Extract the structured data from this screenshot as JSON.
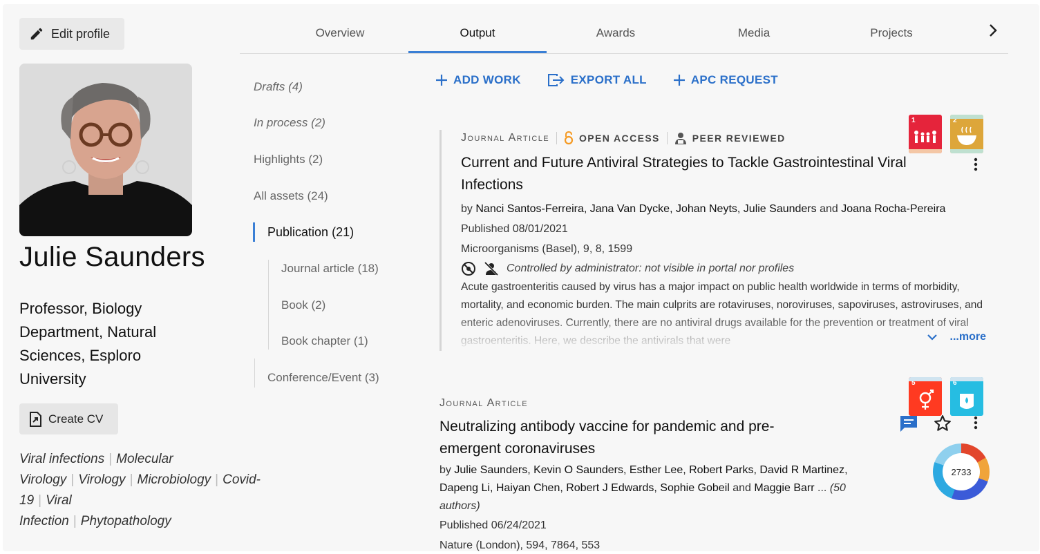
{
  "profile": {
    "edit_label": "Edit profile",
    "name": "Julie Saunders",
    "position": "Professor, Biology Department, Natural Sciences, Esploro University",
    "create_cv_label": "Create CV",
    "keywords": [
      "Viral infections",
      "Molecular Virology",
      "Virology",
      "Microbiology",
      "Covid-19",
      "Viral Infection",
      "Phytopathology"
    ]
  },
  "tabs": [
    {
      "label": "Overview"
    },
    {
      "label": "Output"
    },
    {
      "label": "Awards"
    },
    {
      "label": "Media"
    },
    {
      "label": "Projects"
    }
  ],
  "active_tab": "Output",
  "subnav": {
    "drafts": "Drafts",
    "drafts_count": "(4)",
    "in_process": "In process",
    "in_process_count": "(2)",
    "highlights": "Highlights",
    "highlights_count": "(2)",
    "all_assets": "All assets",
    "all_assets_count": "(24)",
    "publication": "Publication",
    "publication_count": "(21)",
    "journal_article": "Journal article",
    "journal_article_count": "(18)",
    "book": "Book",
    "book_count": "(2)",
    "book_chapter": "Book chapter",
    "book_chapter_count": "(1)",
    "conference": "Conference/Event",
    "conference_count": "(3)"
  },
  "actions": {
    "add_work": "ADD WORK",
    "export_all": "EXPORT ALL",
    "apc_request": "APC REQUEST"
  },
  "result1": {
    "type": "Journal Article",
    "open_access": "OPEN ACCESS",
    "peer_reviewed": "PEER REVIEWED",
    "title": "Current and Future Antiviral Strategies to Tackle Gastrointestinal Viral Infections",
    "by": "by",
    "authors_main": "Nanci Santos-Ferreira, Jana Van Dycke, Johan Neyts, Julie Saunders",
    "and": "and",
    "author_last": "Joana Rocha-Pereira",
    "published": "Published 08/01/2021",
    "source": "Microorganisms (Basel), 9, 8, 1599",
    "admin_note": "Controlled by administrator: not visible in portal nor profiles",
    "abstract": "Acute gastroenteritis caused by virus has a major impact on public health worldwide in terms of morbidity, mortality, and economic burden. The main culprits are rotaviruses, noroviruses, sapoviruses, astroviruses, and enteric adenoviruses. Currently, there are no antiviral drugs available for the prevention or treatment of viral gastroenteritis. Here, we describe the antivirals that were",
    "more": "...more",
    "sdg": [
      {
        "num": "1",
        "color": "#e5243b"
      },
      {
        "num": "2",
        "color": "#dda63a"
      }
    ]
  },
  "result2": {
    "type": "Journal Article",
    "title": "Neutralizing antibody vaccine for pandemic and pre-emergent coronaviruses",
    "by": "by",
    "authors_main": "Julie Saunders, Kevin O Saunders, Esther Lee, Robert Parks, David R Martinez, Dapeng Li, Haiyan Chen, Robert J Edwards, Sophie Gobeil",
    "and": "and",
    "author_last": "Maggie Barr",
    "ellipsis": "...",
    "author_count": "(50 authors)",
    "published": "Published 06/24/2021",
    "source": "Nature (London), 594, 7864, 553",
    "altmetric": "2733",
    "sdg": [
      {
        "num": "5",
        "color": "#ff3a21"
      },
      {
        "num": "6",
        "color": "#26bde2"
      }
    ]
  },
  "colors": {
    "accent": "#3a7fd5",
    "link": "#2a6fc9",
    "open_access": "#f59a23"
  }
}
